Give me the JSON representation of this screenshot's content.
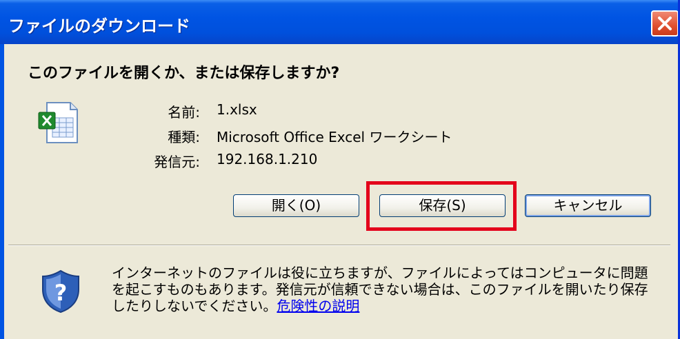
{
  "window": {
    "title": "ファイルのダウンロード"
  },
  "dialog": {
    "question": "このファイルを開くか、または保存しますか?",
    "file_icon": "excel-file-icon",
    "name_label": "名前:",
    "name_value": "1.xlsx",
    "type_label": "種類:",
    "type_value": "Microsoft Office Excel ワークシート",
    "from_label": "発信元:",
    "from_value": "192.168.1.210"
  },
  "buttons": {
    "open": "開く(O)",
    "save": "保存(S)",
    "cancel": "キャンセル"
  },
  "warning": {
    "icon": "security-shield-icon",
    "text": "インターネットのファイルは役に立ちますが、ファイルによってはコンピュータに問題を起こすものもあります。発信元が信頼できない場合は、このファイルを開いたり保存したりしないでください。",
    "link": "危険性の説明"
  },
  "colors": {
    "titlebar": "#0054e3",
    "dialog_bg": "#ece9d8",
    "close_button": "#e0502f",
    "highlight": "#e3001b",
    "link": "#0000ee"
  }
}
